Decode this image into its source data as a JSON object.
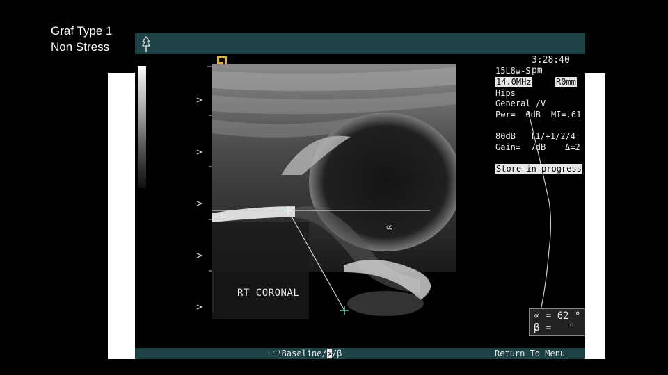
{
  "slide": {
    "title_line1": "Graf Type 1",
    "title_line2": "Non Stress"
  },
  "status": {
    "time": "3:28:40 pm",
    "probe": "15L8w-S",
    "frequency": "14.0MHz",
    "depth": "R0mm",
    "preset": "Hips",
    "mode": "General /V",
    "pwr": "Pwr=  0dB",
    "mi": "MI=.61",
    "dynamic_range": "80dB",
    "persist": "T1/+1/2/4",
    "gain": "Gain=  7dB",
    "delta": "Δ=2",
    "store": "Store in progress"
  },
  "image": {
    "label": "RT CORONAL",
    "alpha_symbol": "∝"
  },
  "angles": {
    "alpha": "∝ = 62 °",
    "beta": "β =   °"
  },
  "menu": {
    "baseline_prefix": "⁽ᶜ⁾Baseline/",
    "baseline_alpha": "∝",
    "baseline_suffix": "/β",
    "return": "Return To Menu"
  },
  "colors": {
    "bar": "#1c4245",
    "text": "#e8e8e8"
  }
}
